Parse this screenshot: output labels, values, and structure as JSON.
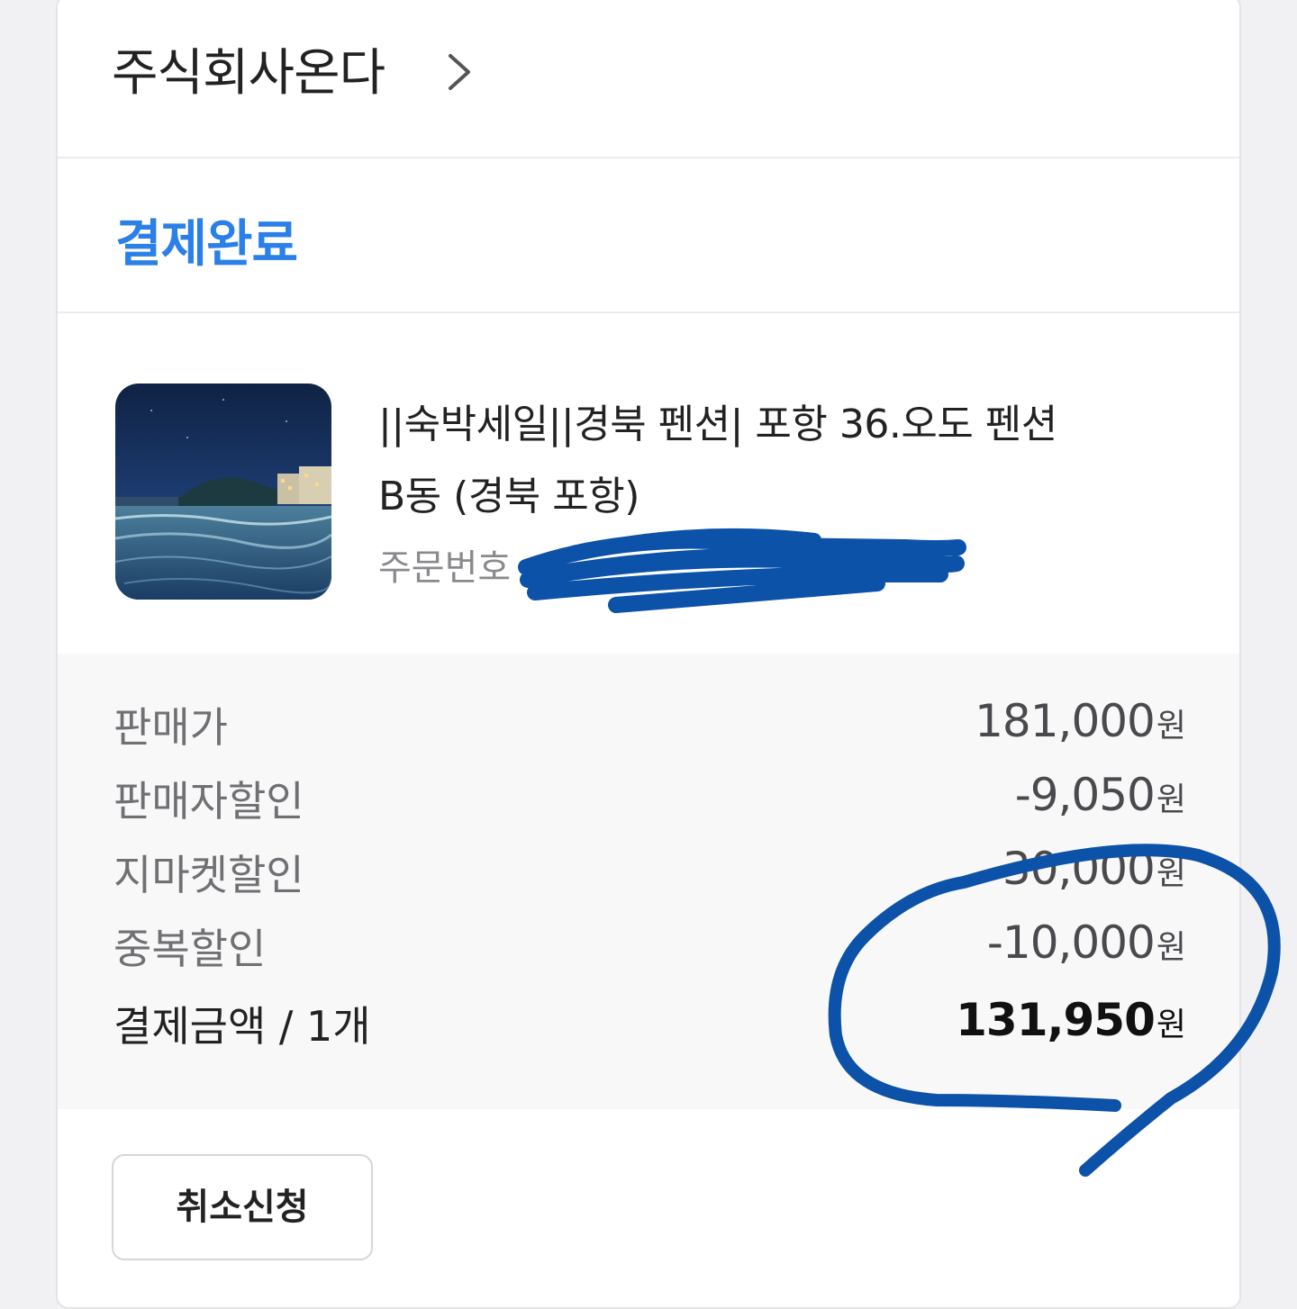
{
  "seller": {
    "name": "주식회사온다",
    "chevron_icon": "chevron-right-icon"
  },
  "order": {
    "status": "결제완료",
    "status_color": "#2a7fe8",
    "product_title": "||숙박세일||경북 펜션| 포항 36.오도 펜션 B동 (경북 포항)",
    "order_number_label": "주문번호"
  },
  "price": {
    "rows": [
      {
        "label": "판매가",
        "value": "181,000",
        "unit": "원"
      },
      {
        "label": "판매자할인",
        "value": "-9,050",
        "unit": "원"
      },
      {
        "label": "지마켓할인",
        "value": "-30,000",
        "unit": "원"
      },
      {
        "label": "중복할인",
        "value": "-10,000",
        "unit": "원"
      },
      {
        "label": "결제금액 / 1개",
        "value": "131,950",
        "unit": "원"
      }
    ]
  },
  "actions": {
    "cancel_label": "취소신청"
  },
  "colors": {
    "annotation_ink": "#0b52a8"
  }
}
